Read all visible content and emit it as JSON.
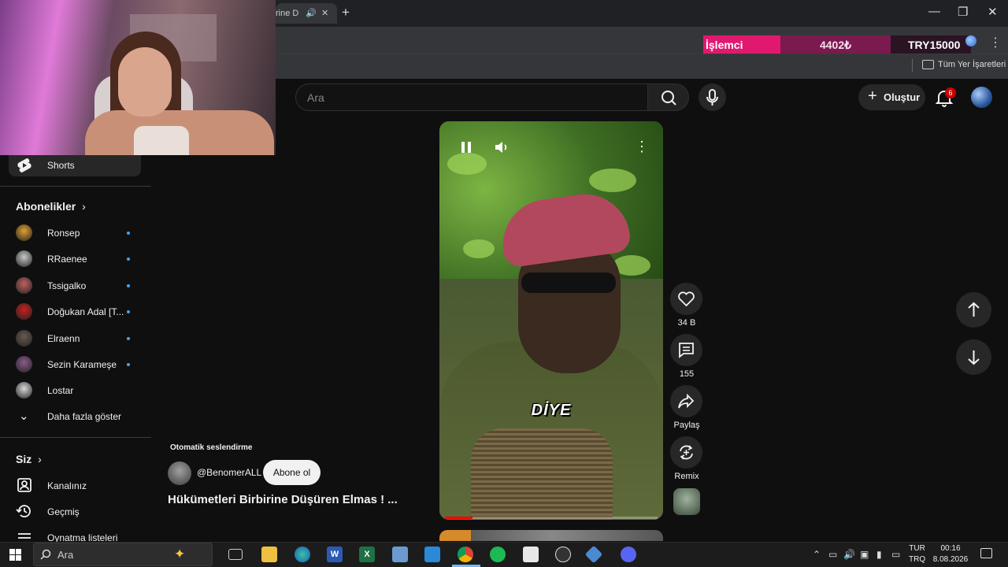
{
  "browser": {
    "tab_title": "rine Dü",
    "new_tab_symbol": "+",
    "window_controls": [
      "—",
      "❐",
      "✕"
    ],
    "ad": {
      "left": "İşlemci",
      "middle": "4402₺",
      "right": "TRY15000"
    },
    "bookmarks_label": "Tüm Yer İşaretleri"
  },
  "header": {
    "search_placeholder": "Ara",
    "create_label": "Oluştur",
    "notification_count": "6"
  },
  "sidebar": {
    "shorts_label": "Shorts",
    "subscriptions_heading": "Abonelikler",
    "subscriptions": [
      {
        "name": "Ronsep",
        "avatar_color": "#e0a030"
      },
      {
        "name": "RRaenee",
        "avatar_color": "#c8c8c8"
      },
      {
        "name": "Tssigalko",
        "avatar_color": "#c06060"
      },
      {
        "name": "Doğukan Adal [T...",
        "avatar_color": "#c82020"
      },
      {
        "name": "Elraenn",
        "avatar_color": "#6a5a50"
      },
      {
        "name": "Sezin Karameşe",
        "avatar_color": "#8a5a8a"
      },
      {
        "name": "Lostar",
        "avatar_color": "#d8d8d8"
      }
    ],
    "show_more_label": "Daha fazla göster",
    "you_heading": "Siz",
    "you_items": [
      {
        "label": "Kanalınız",
        "icon": "channel-icon"
      },
      {
        "label": "Geçmiş",
        "icon": "history-icon"
      },
      {
        "label": "Oynatma listeleri",
        "icon": "playlist-icon"
      }
    ]
  },
  "video": {
    "caption": "DİYE",
    "auto_dub_label": "Otomatik seslendirme",
    "channel_handle": "@BenomerALL",
    "subscribe_label": "Abone ol",
    "title": "Hükümetleri Birbirine Düşüren Elmas ! ...",
    "progress_fraction": 0.13
  },
  "actions": {
    "likes": "34 B",
    "comments": "155",
    "share_label": "Paylaş",
    "remix_label": "Remix"
  },
  "taskbar": {
    "search_label": "Ara",
    "lang_top": "TUR",
    "lang_bottom": "TRQ",
    "time": "00:16",
    "date": "8.08.2026"
  }
}
